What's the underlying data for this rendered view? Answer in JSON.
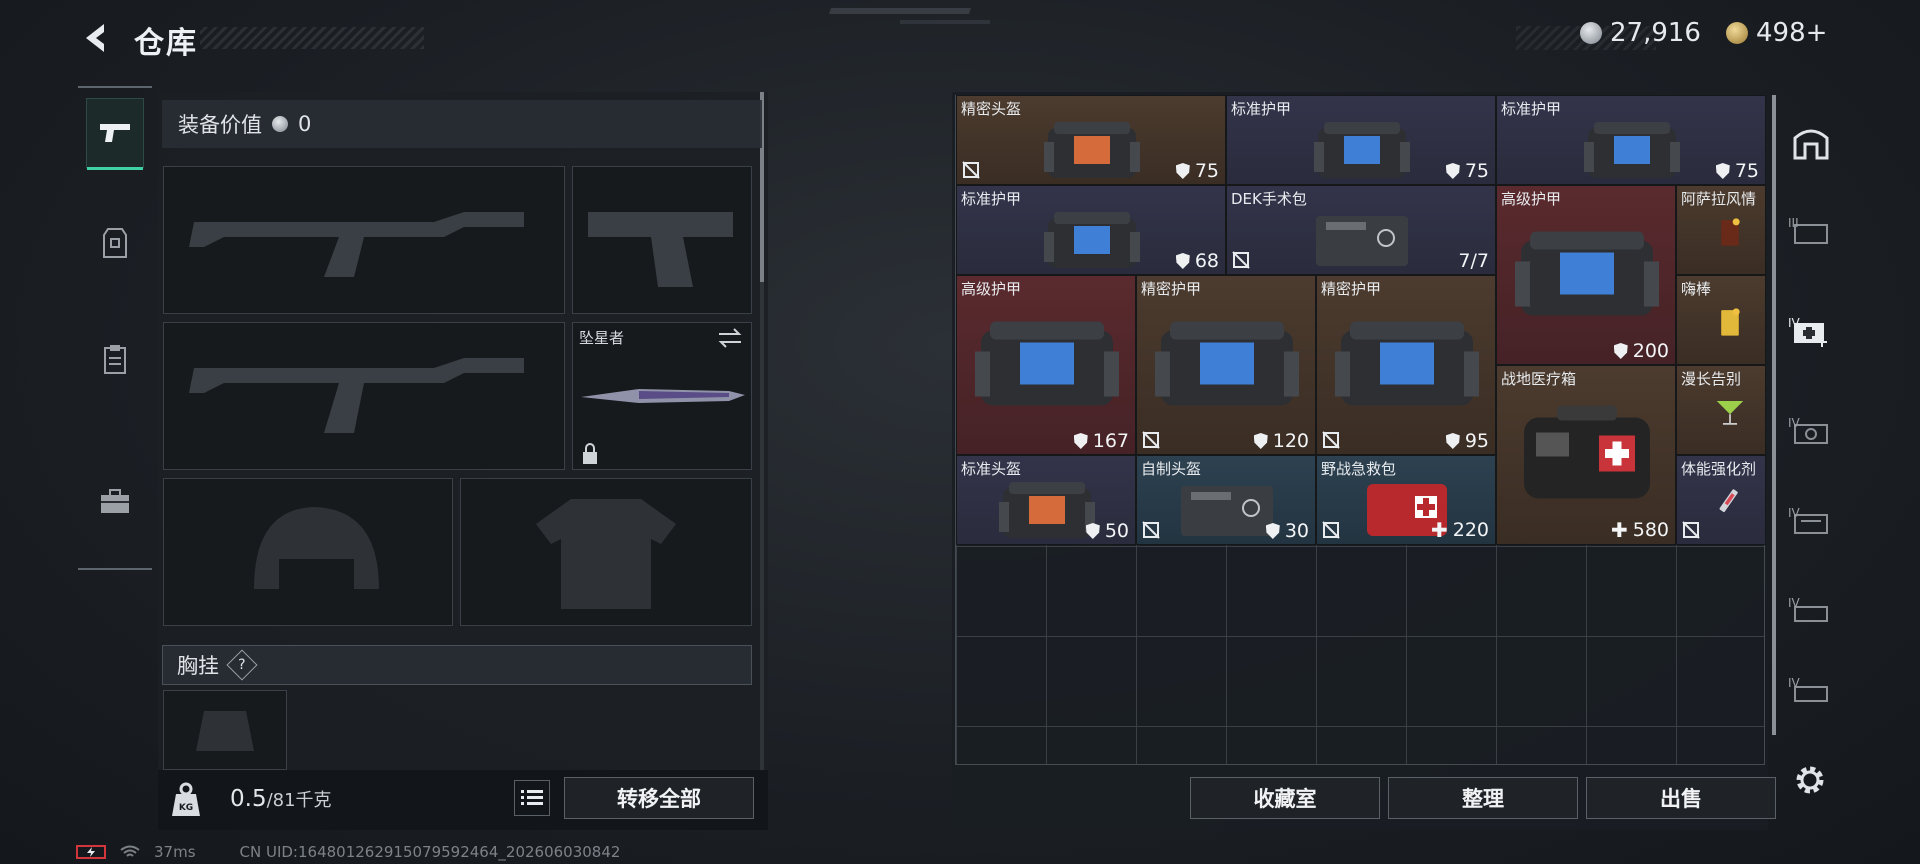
{
  "header": {
    "title": "仓库",
    "silver_amount": "27,916",
    "gold_amount": "498+"
  },
  "left_nav": {
    "items": [
      {
        "name": "weapon",
        "icon": "pistol-icon"
      },
      {
        "name": "armor",
        "icon": "vest-icon"
      },
      {
        "name": "backpack",
        "icon": "clipboard-icon"
      },
      {
        "name": "case",
        "icon": "toolbox-icon"
      }
    ]
  },
  "equipment": {
    "value_label": "装备价值",
    "value_amount": "0",
    "melee_name": "坠星者",
    "chest_label": "胸挂",
    "chest_help": "?"
  },
  "weight": {
    "current": "0.5",
    "max": "/81千克"
  },
  "buttons": {
    "transfer_all": "转移全部",
    "collection": "收藏室",
    "organize": "整理",
    "sell": "出售"
  },
  "items": [
    {
      "name": "精密头盔",
      "value": "75"
    },
    {
      "name": "标准护甲",
      "value": "75"
    },
    {
      "name": "标准护甲",
      "value": "75"
    },
    {
      "name": "标准护甲",
      "value": "68"
    },
    {
      "name": "DEK手术包",
      "value": "7/7"
    },
    {
      "name": "高级护甲",
      "value": "200"
    },
    {
      "name": "阿萨拉风情",
      "value": ""
    },
    {
      "name": "嗨棒",
      "value": ""
    },
    {
      "name": "高级护甲",
      "value": "167"
    },
    {
      "name": "精密护甲",
      "value": "120"
    },
    {
      "name": "精密护甲",
      "value": "95"
    },
    {
      "name": "战地医疗箱",
      "value": "580"
    },
    {
      "name": "漫长告别",
      "value": ""
    },
    {
      "name": "标准头盔",
      "value": "50"
    },
    {
      "name": "自制头盔",
      "value": "30"
    },
    {
      "name": "野战急救包",
      "value": "220"
    },
    {
      "name": "体能强化剂",
      "value": ""
    }
  ],
  "right_tabs": {
    "levels": [
      "III",
      "IV",
      "IV",
      "IV",
      "IV",
      "IV"
    ]
  },
  "status": {
    "ping": "37ms",
    "uid": "CN UID:16480126291507959​2464_202606030842"
  }
}
